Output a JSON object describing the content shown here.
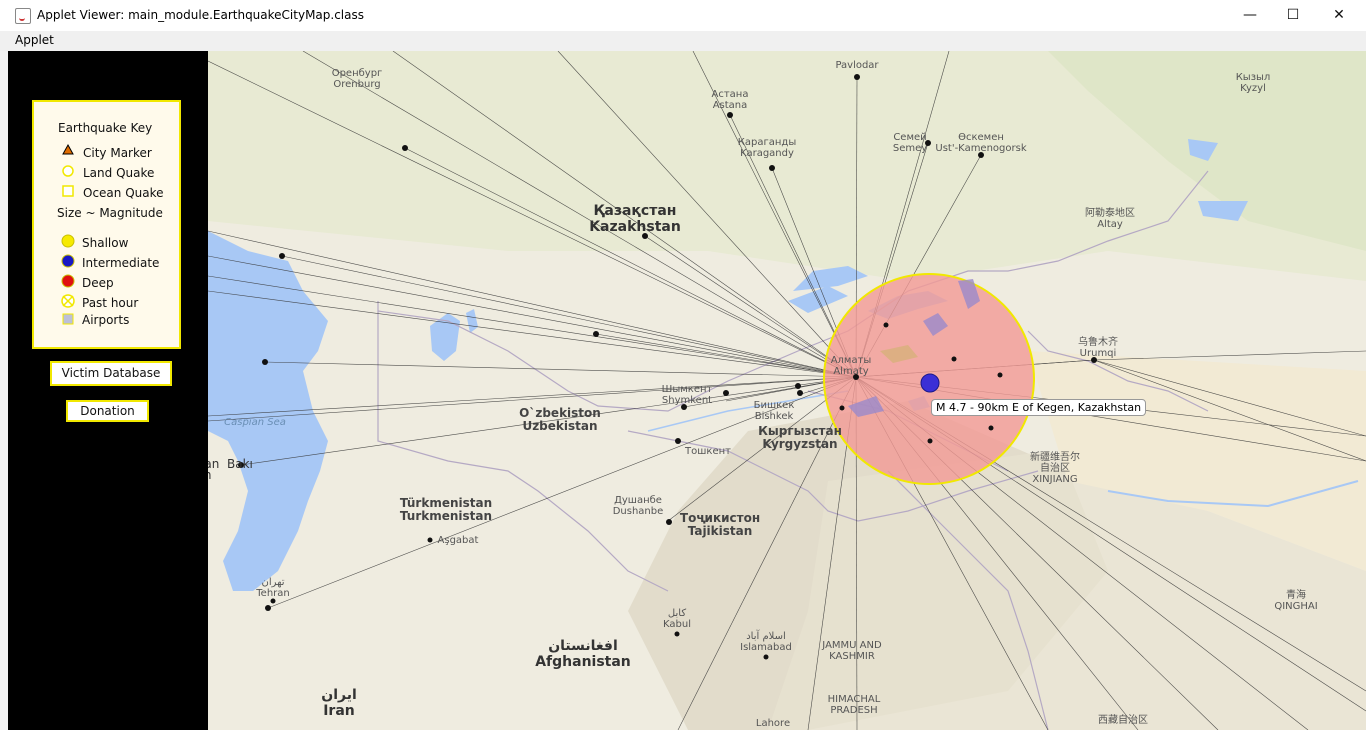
{
  "window": {
    "title": "Applet Viewer: main_module.EarthquakeCityMap.class",
    "minimize": "—",
    "maximize": "☐",
    "close": "✕"
  },
  "menu": {
    "applet": "Applet"
  },
  "key": {
    "title": "Earthquake Key",
    "items": [
      "City Marker",
      "Land Quake",
      "Ocean Quake"
    ],
    "size_label": "Size ~ Magnitude",
    "depth": [
      "Shallow",
      "Intermediate",
      "Deep",
      "Past hour",
      "Airports"
    ]
  },
  "buttons": {
    "victim": "Victim Database",
    "donation": "Donation"
  },
  "map": {
    "tooltip": "M 4.7 - 90km E of Kegen, Kazakhstan",
    "labels": [
      {
        "id": "pavlodar",
        "text": "Pavlodar"
      },
      {
        "id": "orenburg",
        "text": "Оренбург\nOrenburg"
      },
      {
        "id": "astana",
        "text": "Астана\nAstana"
      },
      {
        "id": "karaganda",
        "text": "Караганды\nKaragandy"
      },
      {
        "id": "semey",
        "text": "Семей\nSemey"
      },
      {
        "id": "ust",
        "text": "Өскемен\nUst'-Kamenogorsk"
      },
      {
        "id": "kazakhstan",
        "text": "Қазақстан\nKazakhstan"
      },
      {
        "id": "altay",
        "text": "阿勒泰地区\nAltay"
      },
      {
        "id": "kyzyl",
        "text": "Кызыл\nKyzyl"
      },
      {
        "id": "urumqi",
        "text": "乌鲁木齐\nUrumqi"
      },
      {
        "id": "almaty",
        "text": "Алматы\nAlmaty"
      },
      {
        "id": "shymkent",
        "text": "Шымкент\nShymkent"
      },
      {
        "id": "bishkek",
        "text": "Бишкек\nBishkek"
      },
      {
        "id": "kyrgyzstan",
        "text": "Кыргызстан\nKyrgyzstan"
      },
      {
        "id": "uzbekistan",
        "text": "O`zbekiston\nUzbekistan"
      },
      {
        "id": "caspian",
        "text": "Caspian Sea"
      },
      {
        "id": "baku",
        "text": "rcan  Bakı\njan"
      },
      {
        "id": "toshkent",
        "text": "Тошкент"
      },
      {
        "id": "turkmenistan",
        "text": "Türkmenistan\nTurkmenistan"
      },
      {
        "id": "ashgabat",
        "text": "Aşgabat"
      },
      {
        "id": "dushanbe",
        "text": "Душанбе\nDushanbe"
      },
      {
        "id": "tajikistan",
        "text": "Тоҷикистон\nTajikistan"
      },
      {
        "id": "xinjiang",
        "text": "新疆维吾尔\n自治区\nXINJIANG"
      },
      {
        "id": "tehran",
        "text": "تهران\nTehran"
      },
      {
        "id": "kabul",
        "text": "کابل\nKabul"
      },
      {
        "id": "islamabad",
        "text": "اسلام آباد\nIslamabad"
      },
      {
        "id": "jammu",
        "text": "JAMMU AND\nKASHMIR"
      },
      {
        "id": "afghanistan",
        "text": "افغانستان\nAfghanistan"
      },
      {
        "id": "iran",
        "text": "ایران\nIran"
      },
      {
        "id": "himachal",
        "text": "HIMACHAL\nPRADESH"
      },
      {
        "id": "lahore",
        "text": "Lahore"
      },
      {
        "id": "qinghai",
        "text": "青海\nQINGHAI"
      },
      {
        "id": "tibet",
        "text": "西藏自治区"
      }
    ]
  },
  "colors": {
    "accent_yellow": "#f1e800",
    "quake_fill": "#f29a95",
    "quake_center": "#2a1ec9",
    "water": "#a8c8f5",
    "land": "#f0ede1"
  }
}
